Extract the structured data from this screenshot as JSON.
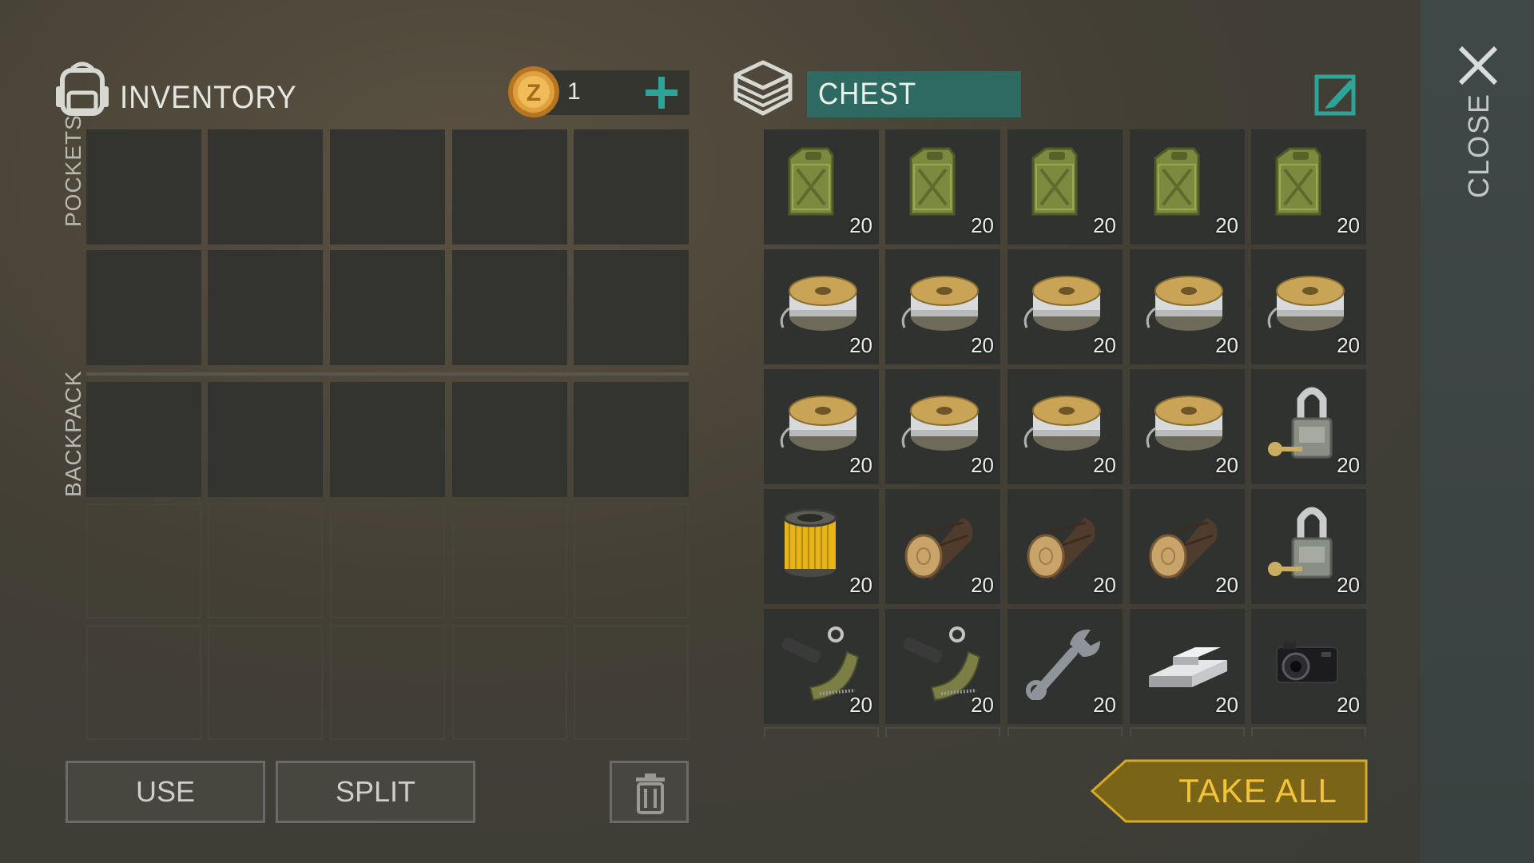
{
  "inventory": {
    "title": "INVENTORY",
    "coins": "1",
    "pockets_label": "POCKETS",
    "backpack_label": "BACKPACK"
  },
  "chest": {
    "title": "CHEST",
    "items": [
      {
        "icon": "jerrycan-icon",
        "qty": "20"
      },
      {
        "icon": "jerrycan-icon",
        "qty": "20"
      },
      {
        "icon": "jerrycan-icon",
        "qty": "20"
      },
      {
        "icon": "jerrycan-icon",
        "qty": "20"
      },
      {
        "icon": "jerrycan-icon",
        "qty": "20"
      },
      {
        "icon": "wire-spool-icon",
        "qty": "20"
      },
      {
        "icon": "wire-spool-icon",
        "qty": "20"
      },
      {
        "icon": "wire-spool-icon",
        "qty": "20"
      },
      {
        "icon": "wire-spool-icon",
        "qty": "20"
      },
      {
        "icon": "wire-spool-icon",
        "qty": "20"
      },
      {
        "icon": "wire-spool-icon",
        "qty": "20"
      },
      {
        "icon": "wire-spool-icon",
        "qty": "20"
      },
      {
        "icon": "wire-spool-icon",
        "qty": "20"
      },
      {
        "icon": "wire-spool-icon",
        "qty": "20"
      },
      {
        "icon": "padlock-icon",
        "qty": "20"
      },
      {
        "icon": "filter-icon",
        "qty": "20"
      },
      {
        "icon": "log-icon",
        "qty": "20"
      },
      {
        "icon": "log-icon",
        "qty": "20"
      },
      {
        "icon": "log-icon",
        "qty": "20"
      },
      {
        "icon": "padlock-icon",
        "qty": "20"
      },
      {
        "icon": "weapon-parts-icon",
        "qty": "20"
      },
      {
        "icon": "weapon-parts-icon",
        "qty": "20"
      },
      {
        "icon": "wrench-icon",
        "qty": "20"
      },
      {
        "icon": "metal-ingots-icon",
        "qty": "20"
      },
      {
        "icon": "camera-icon",
        "qty": "20"
      }
    ]
  },
  "buttons": {
    "use": "USE",
    "split": "SPLIT",
    "take_all": "TAKE ALL",
    "close": "CLOSE"
  },
  "colors": {
    "accent_teal": "#2f8f86",
    "take_all_gold": "#f2c43a",
    "take_all_bg": "#7a6418"
  }
}
